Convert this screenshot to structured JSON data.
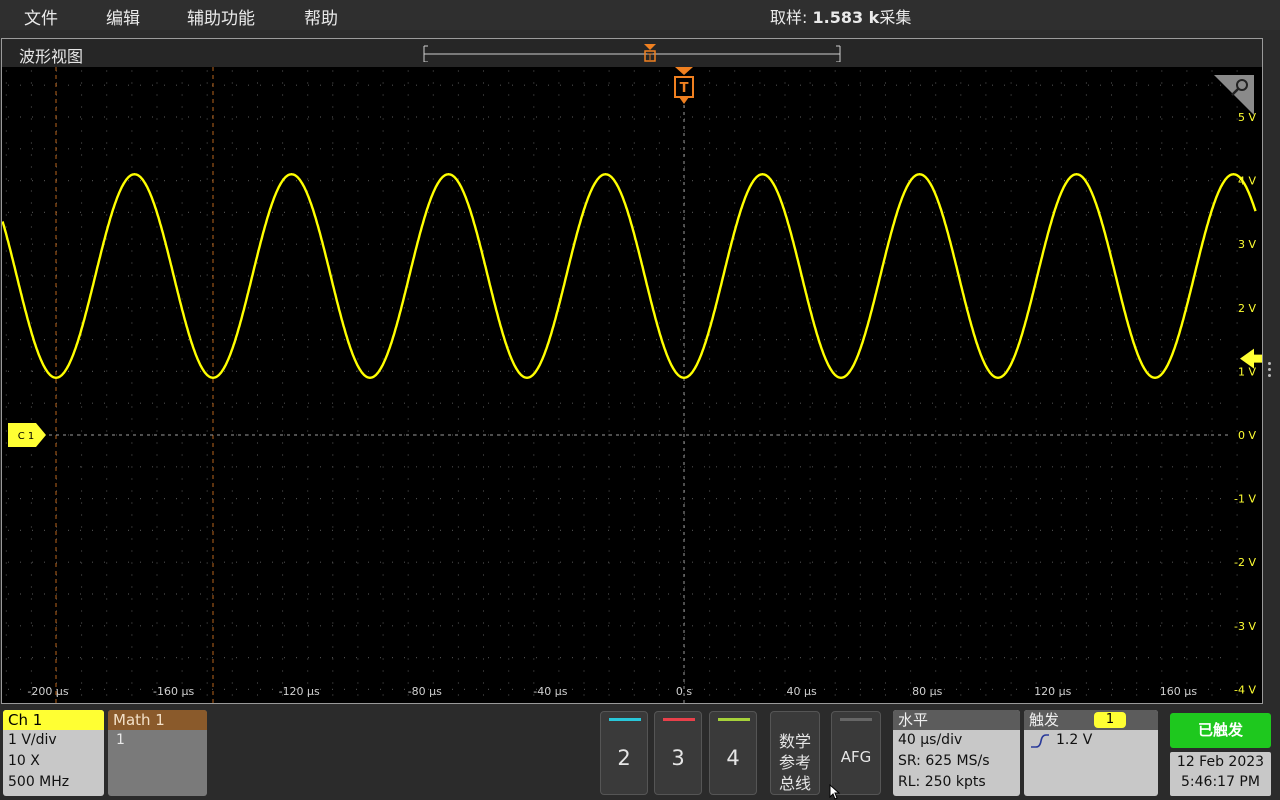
{
  "menu": {
    "file": "文件",
    "edit": "编辑",
    "utility": "辅助功能",
    "help": "帮助",
    "acq_prefix": "取样:",
    "acq_value": "1.583 k",
    "acq_suffix": "采集"
  },
  "waveform_view": {
    "title": "波形视图",
    "channel_label": "C 1",
    "trigger_label": "T",
    "volts_labels": [
      "5 V",
      "4 V",
      "3 V",
      "2 V",
      "1 V",
      "0 V",
      "-1 V",
      "-2 V",
      "-3 V",
      "-4 V"
    ],
    "time_labels": [
      "-200 µs",
      "-160 µs",
      "-120 µs",
      "-80 µs",
      "-40 µs",
      "0 s",
      "40 µs",
      "80 µs",
      "120 µs",
      "160 µs"
    ],
    "trigger_level_v": 1.2
  },
  "chart_data": {
    "type": "line",
    "series": [
      {
        "x_range_us": [
          -218,
          182
        ],
        "offset_v": 2.5,
        "amplitude_v": 1.6,
        "period_us": 50,
        "phase_min_at_us": 0
      }
    ],
    "ylim": [
      -4,
      5.5
    ],
    "yticks": [
      5,
      4,
      3,
      2,
      1,
      0,
      -1,
      -2,
      -3,
      -4
    ],
    "xticks": [
      -200,
      -160,
      -120,
      -80,
      -40,
      0,
      40,
      80,
      120,
      160
    ],
    "grid": true,
    "color": "#ffff00"
  },
  "bottom": {
    "ch1": {
      "title": "Ch 1",
      "scale": "1 V/div",
      "probe": "10 X",
      "bandwidth": "500 MHz"
    },
    "math1": {
      "title": "Math 1",
      "source": "1"
    },
    "channel_buttons": [
      {
        "num": "2",
        "color": "#29c7d9"
      },
      {
        "num": "3",
        "color": "#e8404a"
      },
      {
        "num": "4",
        "color": "#a6d23a"
      }
    ],
    "math_ref_bus": [
      "数学",
      "参考",
      "总线"
    ],
    "afg": "AFG",
    "horizontal": {
      "title": "水平",
      "scale": "40 µs/div",
      "sr": "SR: 625 MS/s",
      "rl": "RL: 250 kpts"
    },
    "trigger": {
      "title": "触发",
      "source": "1",
      "level": "1.2 V"
    },
    "status": "已触发",
    "date": "12 Feb 2023",
    "time": "5:46:17 PM"
  }
}
